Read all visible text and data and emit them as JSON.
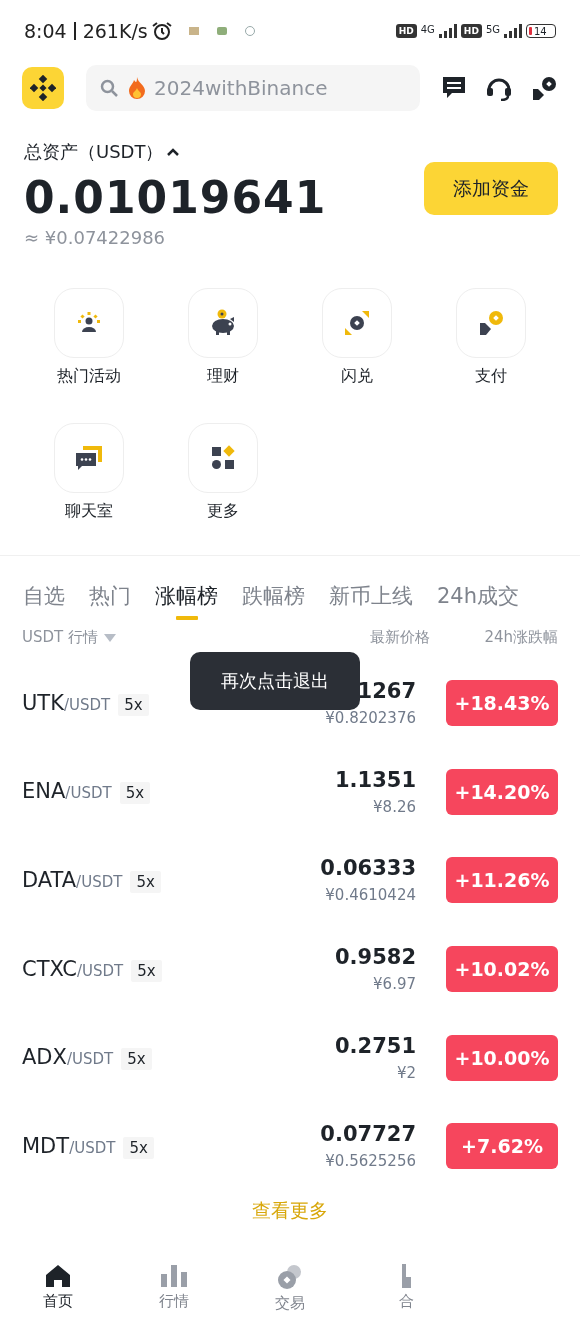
{
  "status_bar": {
    "time": "8:04",
    "speed": "261K/s",
    "hd_1": "HD",
    "network_1": "4G",
    "hd_2": "HD",
    "network_2": "5G",
    "battery": "14"
  },
  "search": {
    "placeholder": "2024withBinance"
  },
  "assets": {
    "label": "总资产（USDT）",
    "total": "0.01019641",
    "fiat": "≈ ¥0.07422986",
    "button": "添加资金"
  },
  "shortcuts": [
    {
      "kind": "activity",
      "label": "热门活动"
    },
    {
      "kind": "earn",
      "label": "理财"
    },
    {
      "kind": "convert",
      "label": "闪兑"
    },
    {
      "kind": "pay",
      "label": "支付"
    },
    {
      "kind": "chat",
      "label": "聊天室"
    },
    {
      "kind": "more",
      "label": "更多"
    }
  ],
  "tabs": [
    {
      "label": "自选",
      "selected": false
    },
    {
      "label": "热门",
      "selected": false
    },
    {
      "label": "涨幅榜",
      "selected": true
    },
    {
      "label": "跌幅榜",
      "selected": false
    },
    {
      "label": "新币上线",
      "selected": false
    },
    {
      "label": "24h成交",
      "selected": false
    }
  ],
  "table": {
    "columns": [
      "USDT 行情",
      "最新价格",
      "24h涨跌幅"
    ],
    "rows": [
      {
        "base": "UTK",
        "quote": "/USDT",
        "leverage": "5x",
        "price": "1267",
        "fiat": "¥0.8202376",
        "change": "+18.43%"
      },
      {
        "base": "ENA",
        "quote": "/USDT",
        "leverage": "5x",
        "price": "1.1351",
        "fiat": "¥8.26",
        "change": "+14.20%"
      },
      {
        "base": "DATA",
        "quote": "/USDT",
        "leverage": "5x",
        "price": "0.06333",
        "fiat": "¥0.4610424",
        "change": "+11.26%"
      },
      {
        "base": "CTXC",
        "quote": "/USDT",
        "leverage": "5x",
        "price": "0.9582",
        "fiat": "¥6.97",
        "change": "+10.02%"
      },
      {
        "base": "ADX",
        "quote": "/USDT",
        "leverage": "5x",
        "price": "0.2751",
        "fiat": "¥2",
        "change": "+10.00%"
      },
      {
        "base": "MDT",
        "quote": "/USDT",
        "leverage": "5x",
        "price": "0.07727",
        "fiat": "¥0.5625256",
        "change": "+7.62%"
      }
    ],
    "more": "查看更多"
  },
  "toast": "再次点击退出",
  "nav": [
    {
      "kind": "home",
      "label": "首页",
      "selected": true
    },
    {
      "kind": "markets",
      "label": "行情",
      "selected": false
    },
    {
      "kind": "trade",
      "label": "交易",
      "selected": false
    },
    {
      "kind": "futures",
      "label": "合",
      "selected": false
    }
  ]
}
